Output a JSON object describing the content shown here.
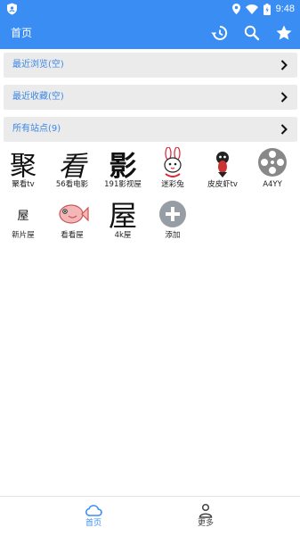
{
  "status_bar": {
    "time": "9:48",
    "icons": [
      "shield-icon",
      "location-icon",
      "wifi-icon",
      "battery-icon"
    ]
  },
  "app_bar": {
    "title": "首页",
    "actions": [
      "history-icon",
      "search-icon",
      "star-icon"
    ]
  },
  "sections": [
    {
      "label": "最近浏览(空)"
    },
    {
      "label": "最近收藏(空)"
    },
    {
      "label": "所有站点(9)"
    }
  ],
  "sites": [
    {
      "name": "聚看tv",
      "glyph": "聚"
    },
    {
      "name": "56看电影",
      "glyph": "看"
    },
    {
      "name": "191影视屋",
      "glyph": "影"
    },
    {
      "name": "迷彩兔",
      "icon": "rabbit-icon"
    },
    {
      "name": "皮皮虾tv",
      "icon": "shrimp-icon"
    },
    {
      "name": "A4YY",
      "icon": "film-reel-icon"
    },
    {
      "name": "新片屋",
      "glyph": "屋"
    },
    {
      "name": "看看屋",
      "icon": "fish-icon"
    },
    {
      "name": "4k屋",
      "glyph": "屋"
    },
    {
      "name": "添加",
      "icon": "add-icon"
    }
  ],
  "bottom_nav": [
    {
      "label": "首页",
      "icon": "cloud-icon",
      "active": true
    },
    {
      "label": "更多",
      "icon": "person-icon",
      "active": false
    }
  ],
  "colors": {
    "primary": "#3a8ef3",
    "section_bg": "#ebebeb",
    "section_text": "#3b87e5",
    "active_nav": "#3a8ef3",
    "inactive_nav": "#444444"
  }
}
